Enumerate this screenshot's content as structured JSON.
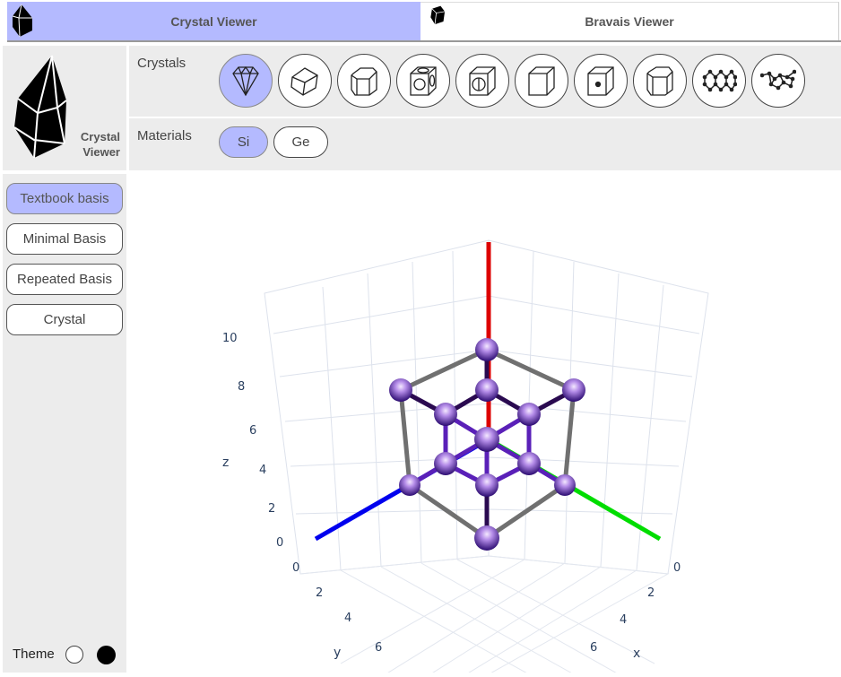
{
  "tabs": [
    {
      "label": "Crystal Viewer",
      "active": true
    },
    {
      "label": "Bravais Viewer",
      "active": false
    }
  ],
  "logo": {
    "line1": "Crystal",
    "line2": "Viewer"
  },
  "crystals": {
    "label": "Crystals",
    "items": [
      {
        "icon": "diamond-icon",
        "active": true
      },
      {
        "icon": "rhombohedral-icon",
        "active": false
      },
      {
        "icon": "hexagonal-prism-icon",
        "active": false
      },
      {
        "icon": "rocksalt-cube-icon",
        "active": false
      },
      {
        "icon": "cube-circle-icon",
        "active": false
      },
      {
        "icon": "cube-icon",
        "active": false
      },
      {
        "icon": "body-centered-cube-icon",
        "active": false
      },
      {
        "icon": "hexagonal-prism-alt-icon",
        "active": false
      },
      {
        "icon": "graphene-icon",
        "active": false
      },
      {
        "icon": "molecule-chain-icon",
        "active": false
      }
    ]
  },
  "materials": {
    "label": "Materials",
    "items": [
      {
        "label": "Si",
        "active": true
      },
      {
        "label": "Ge",
        "active": false
      }
    ]
  },
  "basis_buttons": [
    {
      "label": "Textbook basis",
      "active": true
    },
    {
      "label": "Minimal Basis",
      "active": false
    },
    {
      "label": "Repeated Basis",
      "active": false
    },
    {
      "label": "Crystal",
      "active": false
    }
  ],
  "theme": {
    "label": "Theme"
  },
  "plot": {
    "z_label": "z",
    "y_label": "y",
    "x_label": "x",
    "z_ticks": [
      "0",
      "2",
      "4",
      "6",
      "8",
      "10"
    ],
    "y_ticks": [
      "0",
      "2",
      "4",
      "6"
    ],
    "x_ticks": [
      "0",
      "2",
      "4",
      "6"
    ],
    "colors": {
      "x_axis": "#00dd00",
      "y_axis": "#0000ee",
      "z_axis": "#dd0000",
      "atom": "#7a4fd0",
      "bond": "#5a20b8",
      "cell": "#707070"
    }
  }
}
